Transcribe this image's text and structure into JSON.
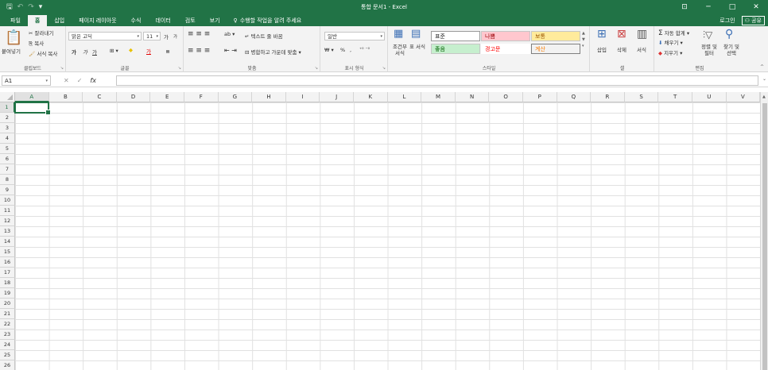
{
  "window": {
    "title": "통합 문서1 - Excel",
    "qat": {
      "save": "🖫",
      "undo": "↶",
      "redo": "↷",
      "customize": "▾"
    },
    "controls": {
      "ribbon_display": "⊡",
      "minimize": "─",
      "maximize": "□",
      "close": "✕"
    }
  },
  "tabs": [
    "파일",
    "홈",
    "삽입",
    "페이지 레이아웃",
    "수식",
    "데이터",
    "검토",
    "보기"
  ],
  "tell_me": "수행할 작업을 알려 주세요",
  "account": {
    "login": "로그인",
    "share": "공유"
  },
  "ribbon": {
    "clipboard": {
      "paste": "붙여넣기",
      "cut": "잘라내기",
      "copy": "복사",
      "format_painter": "서식 복사",
      "label": "클립보드"
    },
    "font": {
      "name": "맑은 고딕",
      "size": "11",
      "grow": "가",
      "shrink": "가",
      "bold": "가",
      "italic": "가",
      "underline": "가",
      "label": "글꼴"
    },
    "alignment": {
      "wrap_text": "텍스트 줄 바꿈",
      "merge_center": "병합하고 가운데 맞춤",
      "label": "맞춤"
    },
    "number": {
      "format": "일반",
      "percent": "%",
      "comma": ",",
      "label": "표시 형식"
    },
    "styles": {
      "conditional": "조건부 서식",
      "format_table": "표 서식",
      "cells": [
        "표준",
        "나쁨",
        "보통",
        "좋음",
        "경고문",
        "계산"
      ],
      "label": "스타일"
    },
    "cells": {
      "insert": "삽입",
      "delete": "삭제",
      "format": "서식",
      "label": "셀"
    },
    "editing": {
      "autosum": "자동 합계",
      "fill": "채우기",
      "clear": "지우기",
      "sort_filter": "정렬 및 필터",
      "find_select": "찾기 및 선택",
      "label": "편집"
    }
  },
  "formula_bar": {
    "name_box": "A1",
    "cancel": "✕",
    "enter": "✓",
    "fx": "fx",
    "value": ""
  },
  "grid": {
    "columns": [
      "A",
      "B",
      "C",
      "D",
      "E",
      "F",
      "G",
      "H",
      "I",
      "J",
      "K",
      "L",
      "M",
      "N",
      "O",
      "P",
      "Q",
      "R",
      "S",
      "T",
      "U",
      "V"
    ],
    "rows": [
      "1",
      "2",
      "3",
      "4",
      "5",
      "6",
      "7",
      "8",
      "9",
      "10",
      "11",
      "12",
      "13",
      "14",
      "15",
      "16",
      "17",
      "18",
      "19",
      "20",
      "21",
      "22",
      "23",
      "24",
      "25",
      "26"
    ],
    "selected_cell": "A1"
  },
  "colors": {
    "accent": "#217346",
    "bad_bg": "#ffc7ce",
    "bad_fg": "#9c0006",
    "neutral_bg": "#ffeb9c",
    "neutral_fg": "#9c5700",
    "good_bg": "#c6efce",
    "good_fg": "#006100",
    "warn_fg": "#ff0000",
    "calc_bg": "#f2f2f2",
    "calc_fg": "#fa7d00"
  }
}
